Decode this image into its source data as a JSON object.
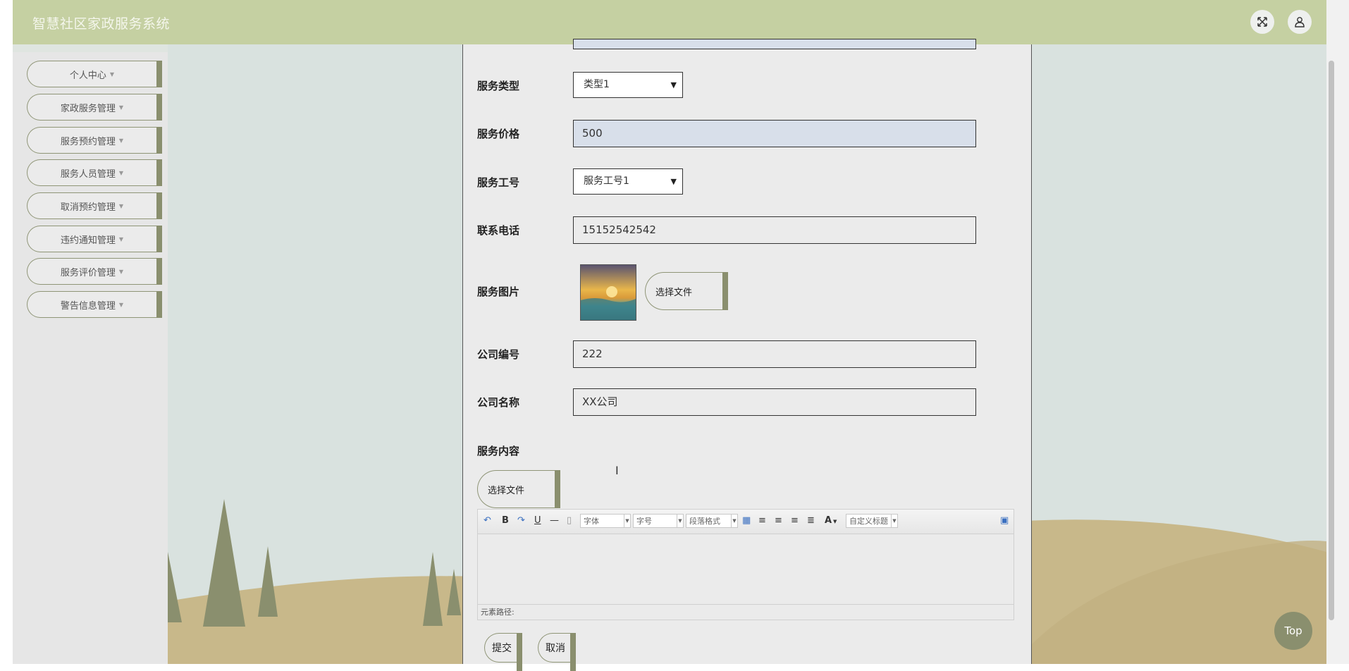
{
  "header": {
    "title": "智慧社区家政服务系统",
    "fullscreen_icon": "fullscreen-icon",
    "user_icon": "user-icon"
  },
  "sidebar": {
    "items": [
      {
        "label": "个人中心"
      },
      {
        "label": "家政服务管理"
      },
      {
        "label": "服务预约管理"
      },
      {
        "label": "服务人员管理"
      },
      {
        "label": "取消预约管理"
      },
      {
        "label": "违约通知管理"
      },
      {
        "label": "服务评价管理"
      },
      {
        "label": "警告信息管理"
      }
    ]
  },
  "form": {
    "service_type": {
      "label": "服务类型",
      "value": "类型1"
    },
    "service_price": {
      "label": "服务价格",
      "value": "500"
    },
    "staff_id": {
      "label": "服务工号",
      "value": "服务工号1"
    },
    "phone": {
      "label": "联系电话",
      "value": "15152542542"
    },
    "service_image": {
      "label": "服务图片",
      "button": "选择文件"
    },
    "company_id": {
      "label": "公司编号",
      "value": "222"
    },
    "company_name": {
      "label": "公司名称",
      "value": "XX公司"
    },
    "service_content": {
      "label": "服务内容",
      "button": "选择文件"
    }
  },
  "editor": {
    "font_select": "字体",
    "size_select": "字号",
    "format_select": "段落格式",
    "custom_title": "自定义标题",
    "bold": "B",
    "underline": "U",
    "font_color": "A",
    "element_path": "元素路径:"
  },
  "actions": {
    "submit": "提交",
    "cancel": "取消"
  },
  "back_to_top": "Top",
  "colors": {
    "header": "#c5d0a2",
    "accent": "#8a8f6e",
    "sand": "#c8b88a"
  }
}
